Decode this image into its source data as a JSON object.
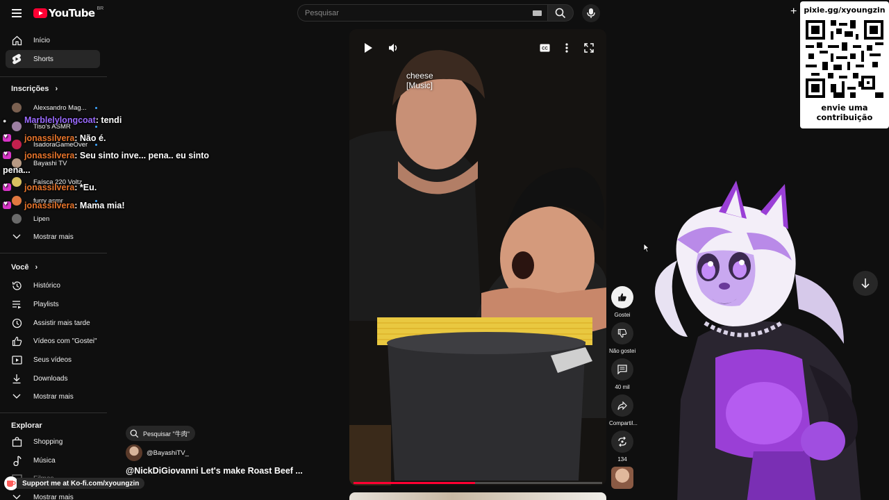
{
  "header": {
    "logo_text": "YouTube",
    "country_code": "BR",
    "search_placeholder": "Pesquisar"
  },
  "sidebar": {
    "main": [
      {
        "label": "Início",
        "icon": "home-icon"
      },
      {
        "label": "Shorts",
        "icon": "shorts-icon",
        "active": true
      }
    ],
    "subscriptions_title": "Inscrições",
    "subscriptions": [
      {
        "label": "Alexsandro Mag...",
        "live": true
      },
      {
        "label": "Tiso's ASMR",
        "live": true
      },
      {
        "label": "IsadoraGameOver",
        "live": true
      },
      {
        "label": "Bayashi TV",
        "live": false
      },
      {
        "label": "Faísca 220 Voltz",
        "live": false
      },
      {
        "label": "furry asmr",
        "live": true
      },
      {
        "label": "Lipen",
        "live": false
      }
    ],
    "show_more": "Mostrar mais",
    "you_title": "Você",
    "you_items": [
      {
        "label": "Histórico",
        "icon": "history-icon"
      },
      {
        "label": "Playlists",
        "icon": "playlists-icon"
      },
      {
        "label": "Assistir mais tarde",
        "icon": "watch-later-icon"
      },
      {
        "label": "Vídeos com \"Gostei\"",
        "icon": "like-icon"
      },
      {
        "label": "Seus vídeos",
        "icon": "your-videos-icon"
      },
      {
        "label": "Downloads",
        "icon": "download-icon"
      }
    ],
    "you_show_more": "Mostrar mais",
    "explore_title": "Explorar",
    "explore_items": [
      {
        "label": "Shopping",
        "icon": "shopping-icon"
      },
      {
        "label": "Música",
        "icon": "music-icon"
      },
      {
        "label": "Filmes",
        "icon": "movies-icon"
      }
    ],
    "explore_show_more": "Mostrar mais"
  },
  "chat": [
    {
      "user": "Marblelylongcoat",
      "message": ": tendi",
      "color": "purple"
    },
    {
      "user": "jonassilvera",
      "message": ": Não é.",
      "color": "orange"
    },
    {
      "user": "jonassilvera",
      "message": ": Seu sinto inve... pena.. eu sinto",
      "continuation": "pena...",
      "color": "orange"
    },
    {
      "user": "jonassilvera",
      "message": ": *Eu.",
      "color": "orange"
    },
    {
      "user": "jonassilvera",
      "message": ": Mama mia!",
      "color": "orange"
    }
  ],
  "player": {
    "caption_line1": "cheese",
    "caption_line2": "[Music]",
    "progress": 0.49
  },
  "actions": {
    "like": "Gostei",
    "dislike": "Não gostei",
    "comments": "40 mil",
    "share": "Compartil...",
    "remix": "134"
  },
  "video": {
    "search_chip": "Pesquisar \"牛肉\"",
    "channel": "@BayashiTV_",
    "title": "@NickDiGiovanni  Let's make Roast Beef ..."
  },
  "overlay": {
    "kofi": "Support me at Ko-fi.com/xyoungzin",
    "qr_url": "pixie.gg/xyoungzin",
    "qr_cta_line1": "envie uma",
    "qr_cta_line2": "contribuição"
  },
  "colors": {
    "accent": "#ff0033",
    "background": "#0f0f0f",
    "chat_user": "#e8742a",
    "chat_user_alt": "#9b6bff",
    "mascot_purple": "#9a3fd6"
  }
}
